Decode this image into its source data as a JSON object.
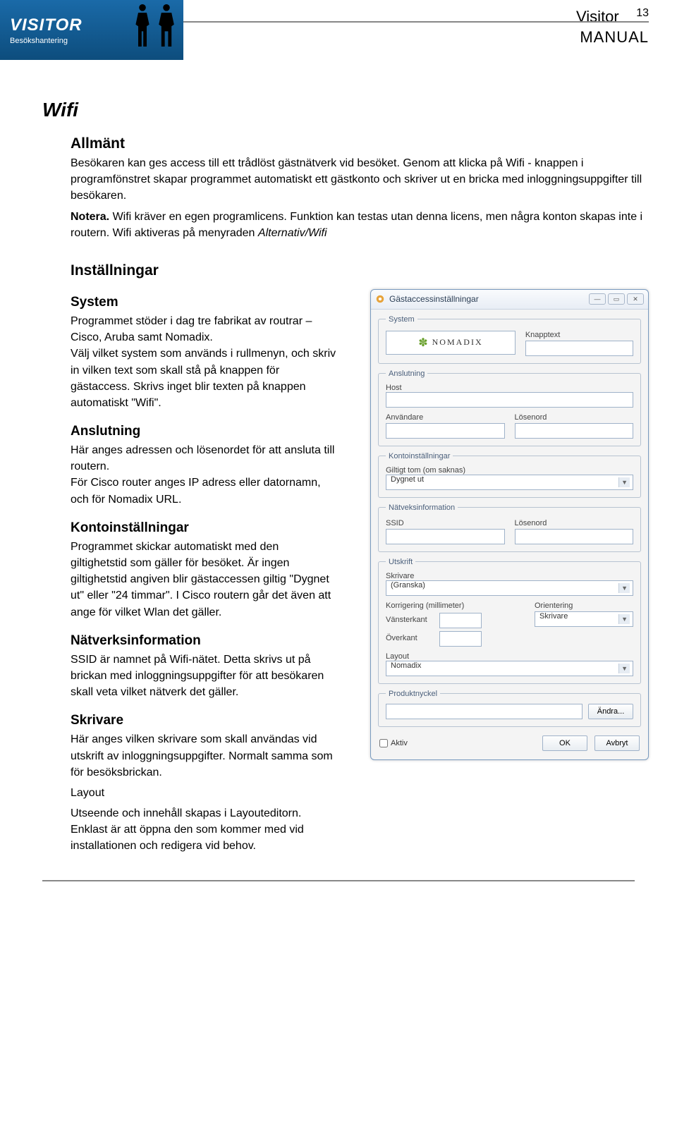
{
  "header": {
    "logo_main": "VISITOR",
    "logo_sub": "Besökshantering",
    "doc_title": "Visitor",
    "doc_subtitle": "MANUAL",
    "page_no": "13"
  },
  "content": {
    "h1": "Wifi",
    "allmant": {
      "title": "Allmänt",
      "p1": "Besökaren kan ges access till ett trådlöst gästnätverk vid besöket. Genom att klicka på Wifi - knappen i programfönstret skapar programmet automatiskt ett gästkonto och skriver ut en bricka med inloggningsuppgifter till besökaren.",
      "notera_label": "Notera.",
      "notera_text": " Wifi kräver en egen programlicens. Funktion kan testas utan denna licens, men några konton skapas inte i routern. Wifi aktiveras på menyraden ",
      "notera_em": "Alternativ/Wifi"
    },
    "installningar": {
      "title": "Inställningar"
    },
    "system": {
      "title": "System",
      "p": "Programmet stöder i dag tre fabrikat av routrar – Cisco, Aruba samt Nomadix.\nVälj vilket system som används i rullmenyn, och skriv in vilken text som skall stå på knappen för gästaccess. Skrivs inget blir texten på knappen automatiskt \"Wifi\"."
    },
    "anslutning": {
      "title": "Anslutning",
      "p": "Här anges adressen och lösenordet för att ansluta till routern.\nFör Cisco router anges IP adress eller datornamn, och för Nomadix URL."
    },
    "konto": {
      "title": "Kontoinställningar",
      "p": "Programmet skickar automatiskt med den giltighetstid som gäller för besöket. Är ingen giltighetstid angiven blir gästaccessen giltig \"Dygnet ut\" eller \"24 timmar\". I Cisco routern går det även att ange för vilket Wlan det gäller."
    },
    "natverk": {
      "title": "Nätverksinformation",
      "p": "SSID är namnet på Wifi-nätet. Detta skrivs ut på brickan med inloggningsuppgifter för att besökaren skall veta vilket nätverk det gäller."
    },
    "skrivare": {
      "title": "Skrivare",
      "p1": "Här anges vilken skrivare som skall användas vid utskrift av inloggningsuppgifter. Normalt samma som för besöksbrickan.",
      "p2_label": "Layout",
      "p2": "Utseende och innehåll skapas i Layouteditorn. Enklast är att öppna den som kommer med vid installationen och redigera vid behov."
    }
  },
  "dialog": {
    "caption": "Gästaccessinställningar",
    "groups": {
      "system": {
        "legend": "System",
        "brand": "NOMADIX",
        "knapptext_label": "Knapptext"
      },
      "anslutning": {
        "legend": "Anslutning",
        "host_label": "Host",
        "anvandare_label": "Användare",
        "losenord_label": "Lösenord"
      },
      "konto": {
        "legend": "Kontoinställningar",
        "giltigt_label": "Giltigt tom (om saknas)",
        "giltigt_value": "Dygnet ut"
      },
      "natverk": {
        "legend": "Nätveksinformation",
        "ssid_label": "SSID",
        "losenord_label": "Lösenord"
      },
      "utskrift": {
        "legend": "Utskrift",
        "skrivare_label": "Skrivare",
        "skrivare_value": "(Granska)",
        "korr_label": "Korrigering (millimeter)",
        "orient_label": "Orientering",
        "left_label": "Vänsterkant",
        "top_label": "Överkant",
        "orient_value": "Skrivare",
        "layout_label": "Layout",
        "layout_value": "Nomadix"
      },
      "nyckel": {
        "legend": "Produktnyckel",
        "andra": "Ändra..."
      }
    },
    "aktiv": "Aktiv",
    "ok": "OK",
    "avbryt": "Avbryt"
  }
}
